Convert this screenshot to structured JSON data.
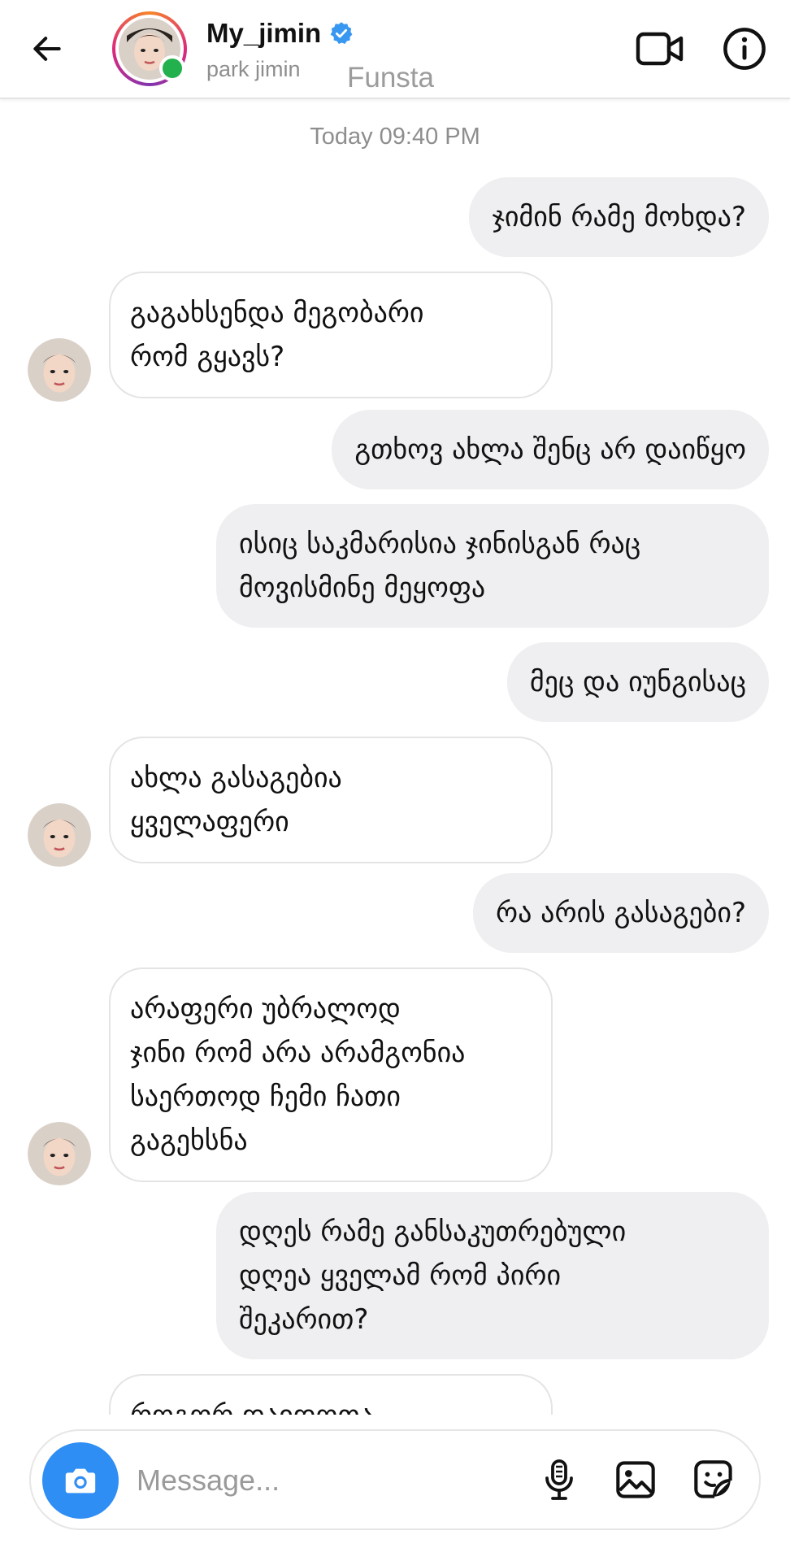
{
  "header": {
    "username": "My_jimin",
    "subname": "park jimin",
    "tag": "Funsta",
    "verified": true,
    "online": true,
    "icons": {
      "back": "arrow-left-icon",
      "video": "video-camera-icon",
      "info": "info-icon",
      "verified": "verified-badge-icon"
    }
  },
  "timestamp": "Today 09:40 PM",
  "messages": [
    {
      "side": "sent",
      "text": "ჯიმინ რამე მოხდა?"
    },
    {
      "side": "received",
      "text": "გაგახსენდა მეგობარი\nრომ გყავს?"
    },
    {
      "side": "sent",
      "text": "გთხოვ ახლა შენც არ დაიწყო"
    },
    {
      "side": "sent",
      "text": "ისიც საკმარისია ჯინისგან რაც\nმოვისმინე მეყოფა"
    },
    {
      "side": "sent",
      "text": "მეც და იუნგისაც"
    },
    {
      "side": "received",
      "text": "ახლა გასაგებია\nყველაფერი"
    },
    {
      "side": "sent",
      "text": "რა არის გასაგები?"
    },
    {
      "side": "received",
      "text": "არაფერი უბრალოდ\nჯინი რომ არა არამგონია\nსაერთოდ ჩემი ჩათი\nგაგეხსნა"
    },
    {
      "side": "sent",
      "text": "დღეს რამე განსაკუთრებული\nდღეა ყველამ რომ პირი\nშეკარით?"
    },
    {
      "side": "received",
      "text": "როგორ დაიდოთა..."
    }
  ],
  "composer": {
    "placeholder": "Message...",
    "icons": {
      "camera": "camera-icon",
      "mic": "microphone-icon",
      "gallery": "image-icon",
      "sticker": "sticker-icon"
    }
  },
  "colors": {
    "sent_bubble": "#efeff1",
    "received_border": "#e4e4e4",
    "camera_button": "#2f8ef4",
    "verified": "#3897f0",
    "online": "#22b14c"
  }
}
